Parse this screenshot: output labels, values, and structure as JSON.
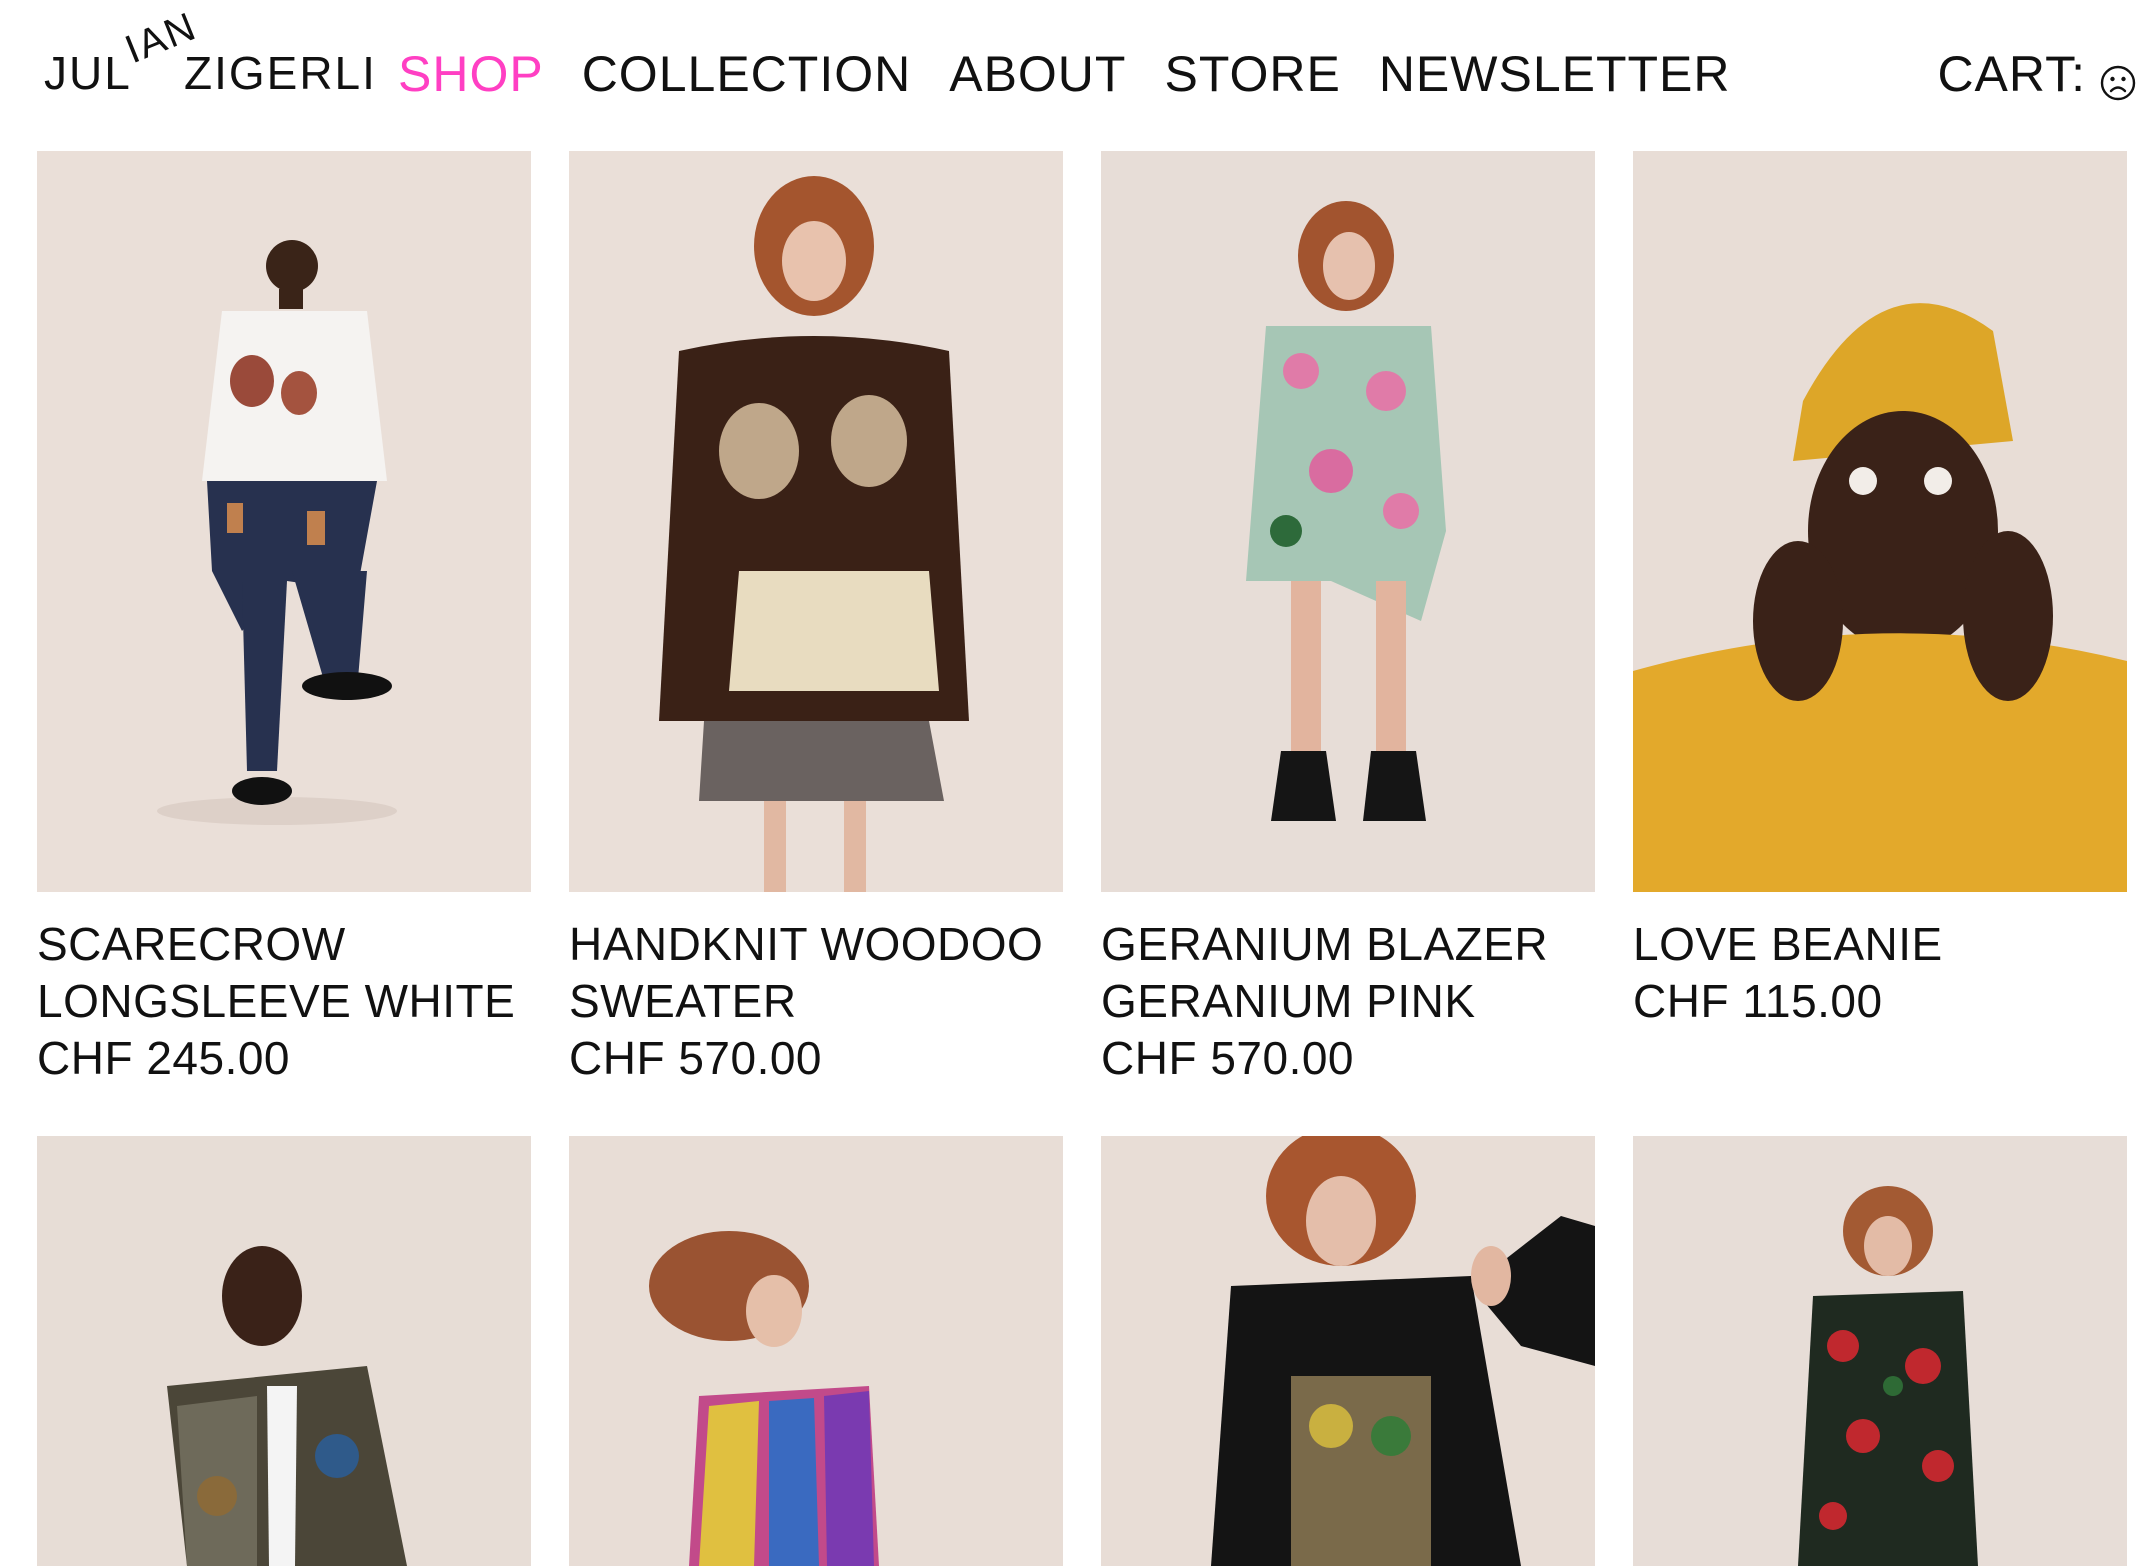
{
  "brand": {
    "first": "JUL",
    "first_tilt": "IAN",
    "last": "ZIGERLI"
  },
  "nav": {
    "items": [
      {
        "label": "SHOP",
        "active": true
      },
      {
        "label": "COLLECTION",
        "active": false
      },
      {
        "label": "ABOUT",
        "active": false
      },
      {
        "label": "STORE",
        "active": false
      },
      {
        "label": "NEWSLETTER",
        "active": false
      }
    ],
    "active_color": "#ff3fc3"
  },
  "cart": {
    "label": "CART:",
    "icon": "sad-face-icon"
  },
  "products": [
    {
      "name": "SCARECROW LONGSLEEVE WHITE",
      "price": "CHF 245.00"
    },
    {
      "name": "HANDKNIT WOODOO SWEATER",
      "price": "CHF 570.00"
    },
    {
      "name": "GERANIUM BLAZER GERANIUM PINK",
      "price": "CHF 570.00"
    },
    {
      "name": "LOVE BEANIE",
      "price": "CHF 115.00"
    }
  ],
  "colors": {
    "photo_background": "#e9ddd6",
    "text": "#111111"
  }
}
